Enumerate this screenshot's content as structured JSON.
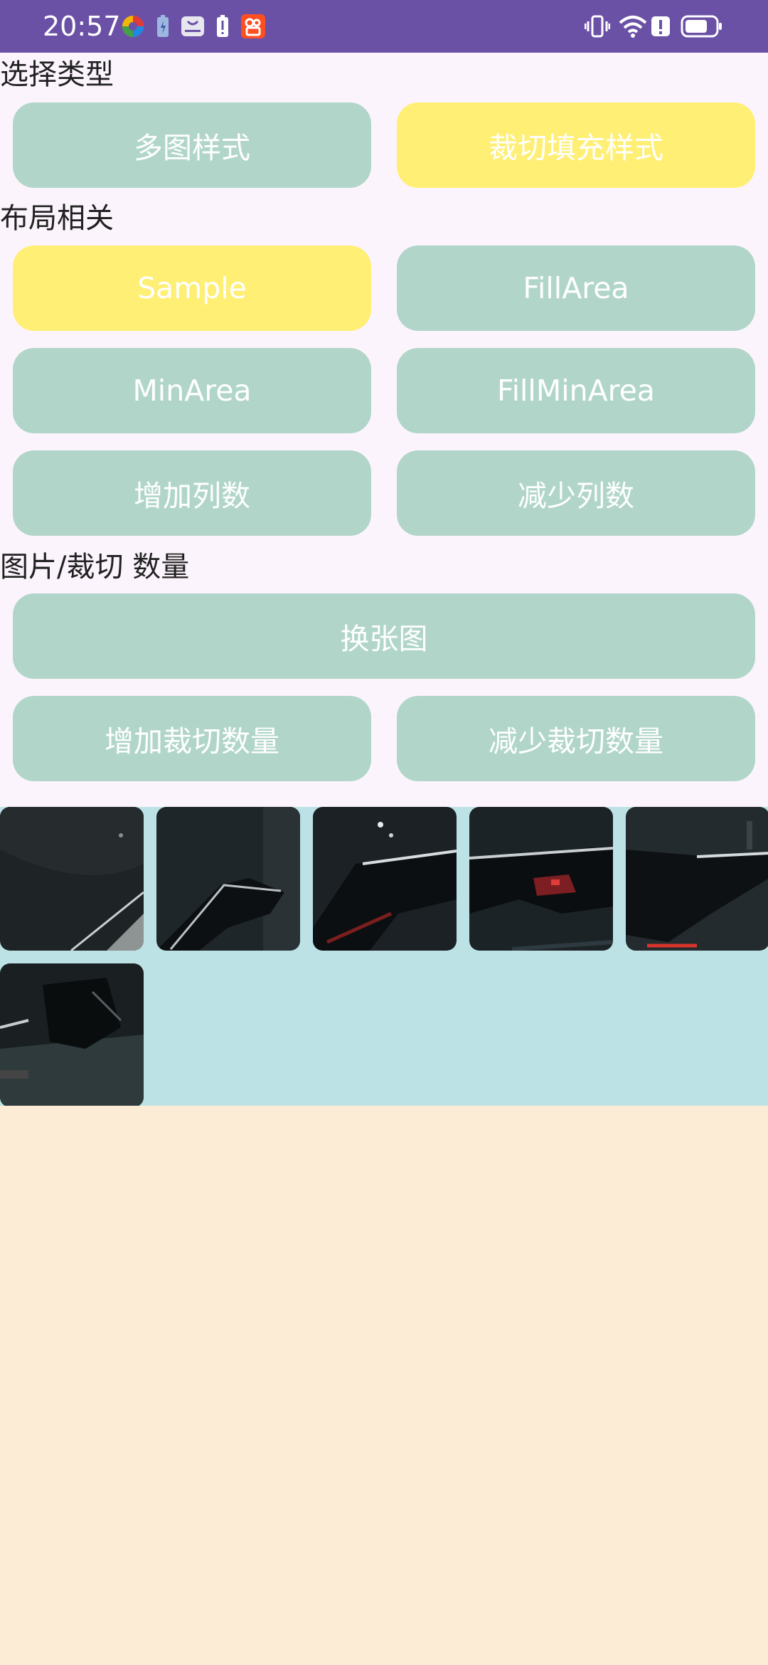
{
  "status_bar": {
    "time": "20:57",
    "icons": [
      "color-wheel-icon",
      "battery-saver-icon",
      "huawei-icon",
      "alert-battery-icon",
      "kuaishou-icon",
      "vibrate-icon",
      "wifi-icon",
      "alert-icon",
      "battery-icon"
    ]
  },
  "sections": {
    "type_label": "选择类型",
    "layout_label": "布局相关",
    "count_label": "图片/裁切 数量"
  },
  "buttons": {
    "multi_style": "多图样式",
    "crop_fill_style": "裁切填充样式",
    "sample": "Sample",
    "fill_area": "FillArea",
    "min_area": "MinArea",
    "fill_min_area": "FillMinArea",
    "add_columns": "增加列数",
    "reduce_columns": "减少列数",
    "change_image": "换张图",
    "add_crop_count": "增加裁切数量",
    "reduce_crop_count": "减少裁切数量"
  },
  "colors": {
    "status_bar": "#6A51A6",
    "button": "#B1D6C9",
    "button_active": "#FFEF75",
    "grid_bg": "#BDE2E6",
    "bottom_bg": "#FCEBD5",
    "page_bg": "#FCF4FC"
  },
  "tiles": [
    "crop-1",
    "crop-2",
    "crop-3",
    "crop-4",
    "crop-5",
    "crop-6"
  ]
}
